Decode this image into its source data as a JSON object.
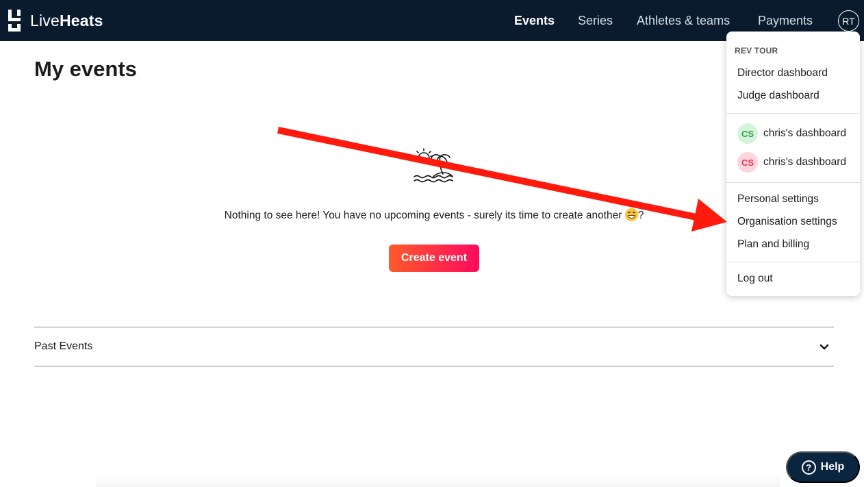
{
  "brand": {
    "name_light": "Live",
    "name_bold": "Heats"
  },
  "nav": {
    "items": [
      {
        "label": "Events",
        "active": true
      },
      {
        "label": "Series",
        "active": false
      },
      {
        "label": "Athletes & teams",
        "active": false
      },
      {
        "label": "Payments",
        "active": false
      }
    ],
    "avatar_initials": "RT"
  },
  "main": {
    "title": "My events",
    "empty_message": "Nothing to see here! You have no upcoming events - surely its time to create another",
    "empty_suffix": "?",
    "empty_icon": "island-icon",
    "create_button": "Create event",
    "past_events_label": "Past Events"
  },
  "dropdown": {
    "org_name": "REV TOUR",
    "dashboards": [
      "Director dashboard",
      "Judge dashboard"
    ],
    "profiles": [
      {
        "initials": "CS",
        "label": "chris's dashboard",
        "bg": "#d6f3dc",
        "fg": "#2fa548"
      },
      {
        "initials": "CS",
        "label": "chris's dashboard",
        "bg": "#ffd4dc",
        "fg": "#e23a55"
      }
    ],
    "settings": [
      "Personal settings",
      "Organisation settings",
      "Plan and billing"
    ],
    "logout": "Log out"
  },
  "help": {
    "label": "Help"
  },
  "colors": {
    "nav_bg": "#0a1b2e",
    "accent_start": "#ff5a2a",
    "accent_end": "#ff0a5f",
    "arrow": "#ff1a0d",
    "help_bg": "#0a2540"
  }
}
